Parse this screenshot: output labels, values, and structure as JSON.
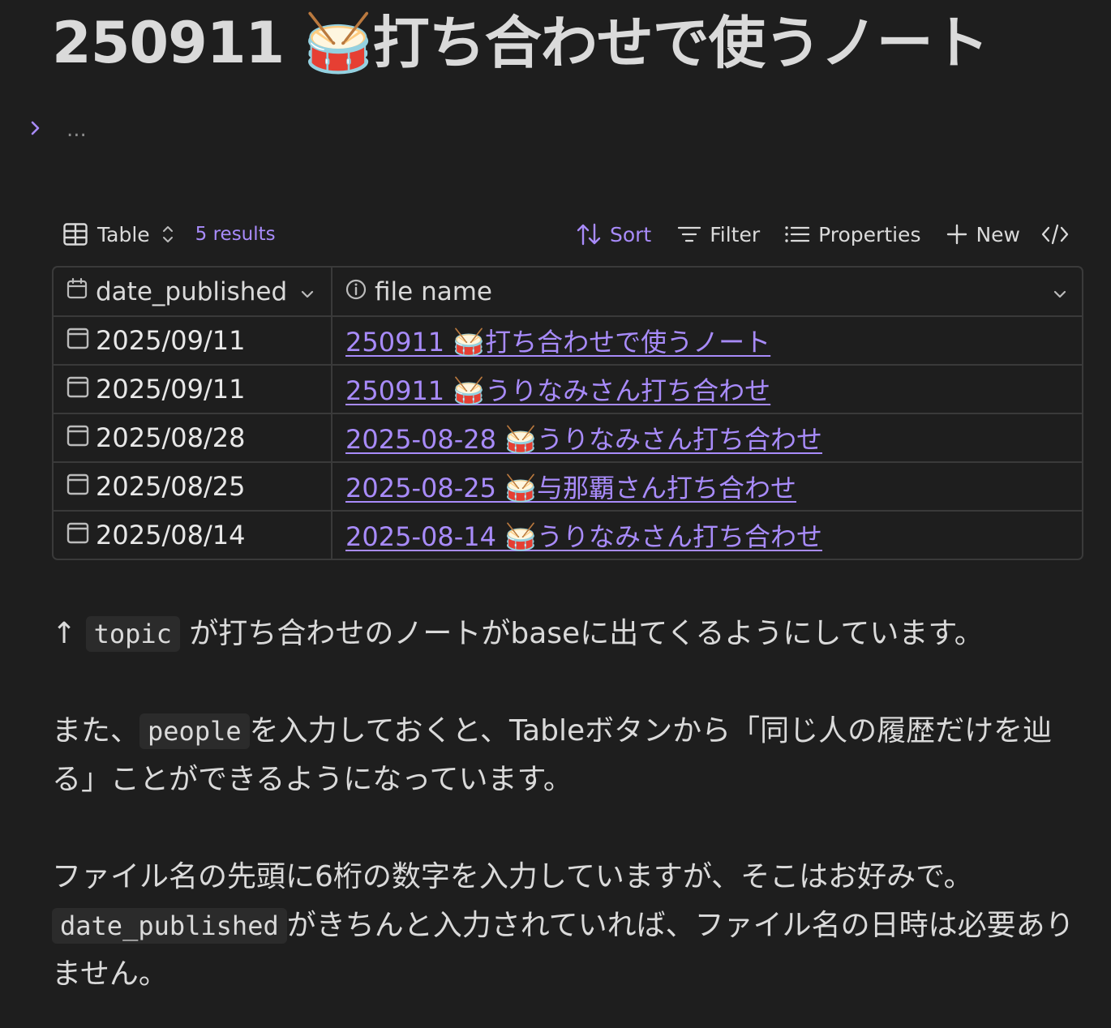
{
  "note": {
    "title": "250911 🥁打ち合わせで使うノート",
    "callout_collapsed_text": "..."
  },
  "base": {
    "toolbar": {
      "view_label": "Table",
      "results_count": "5 results",
      "sort_label": "Sort",
      "filter_label": "Filter",
      "properties_label": "Properties",
      "new_label": "New"
    },
    "columns": [
      "date_published",
      "file name"
    ],
    "rows": [
      {
        "date": "2025/09/11",
        "file": "250911 🥁打ち合わせで使うノート"
      },
      {
        "date": "2025/09/11",
        "file": "250911 🥁うりなみさん打ち合わせ"
      },
      {
        "date": "2025/08/28",
        "file": "2025-08-28 🥁うりなみさん打ち合わせ"
      },
      {
        "date": "2025/08/25",
        "file": "2025-08-25 🥁与那覇さん打ち合わせ"
      },
      {
        "date": "2025/08/14",
        "file": "2025-08-14 🥁うりなみさん打ち合わせ"
      }
    ]
  },
  "body": {
    "p1": {
      "prefix": "↑ ",
      "code": "topic",
      "text": " が打ち合わせのノートがbaseに出てくるようにしています。"
    },
    "p2": {
      "prefix": "また、",
      "code": "people",
      "text": "を入力しておくと、Tableボタンから「同じ人の履歴だけを辿る」ことができるようになっています。"
    },
    "p3": {
      "line1": "ファイル名の先頭に6桁の数字を入力していますが、そこはお好みで。",
      "code": "date_published",
      "text": "がきちんと入力されていれば、ファイル名の日時は必要ありません。"
    }
  },
  "colors": {
    "background": "#1e1e1e",
    "text": "#dadada",
    "accent": "#a88bfa",
    "border": "#3a3a3a"
  },
  "icons": {
    "callout": "chevron-right-icon",
    "view": "table-icon",
    "view_switch": "chevron-up-down-icon",
    "sort": "sort-arrows-icon",
    "filter": "filter-icon",
    "properties": "list-icon",
    "new": "plus-icon",
    "embed": "code-icon",
    "date_column": "calendar-icon",
    "file_column": "info-icon",
    "column_menu": "chevron-down-icon"
  }
}
